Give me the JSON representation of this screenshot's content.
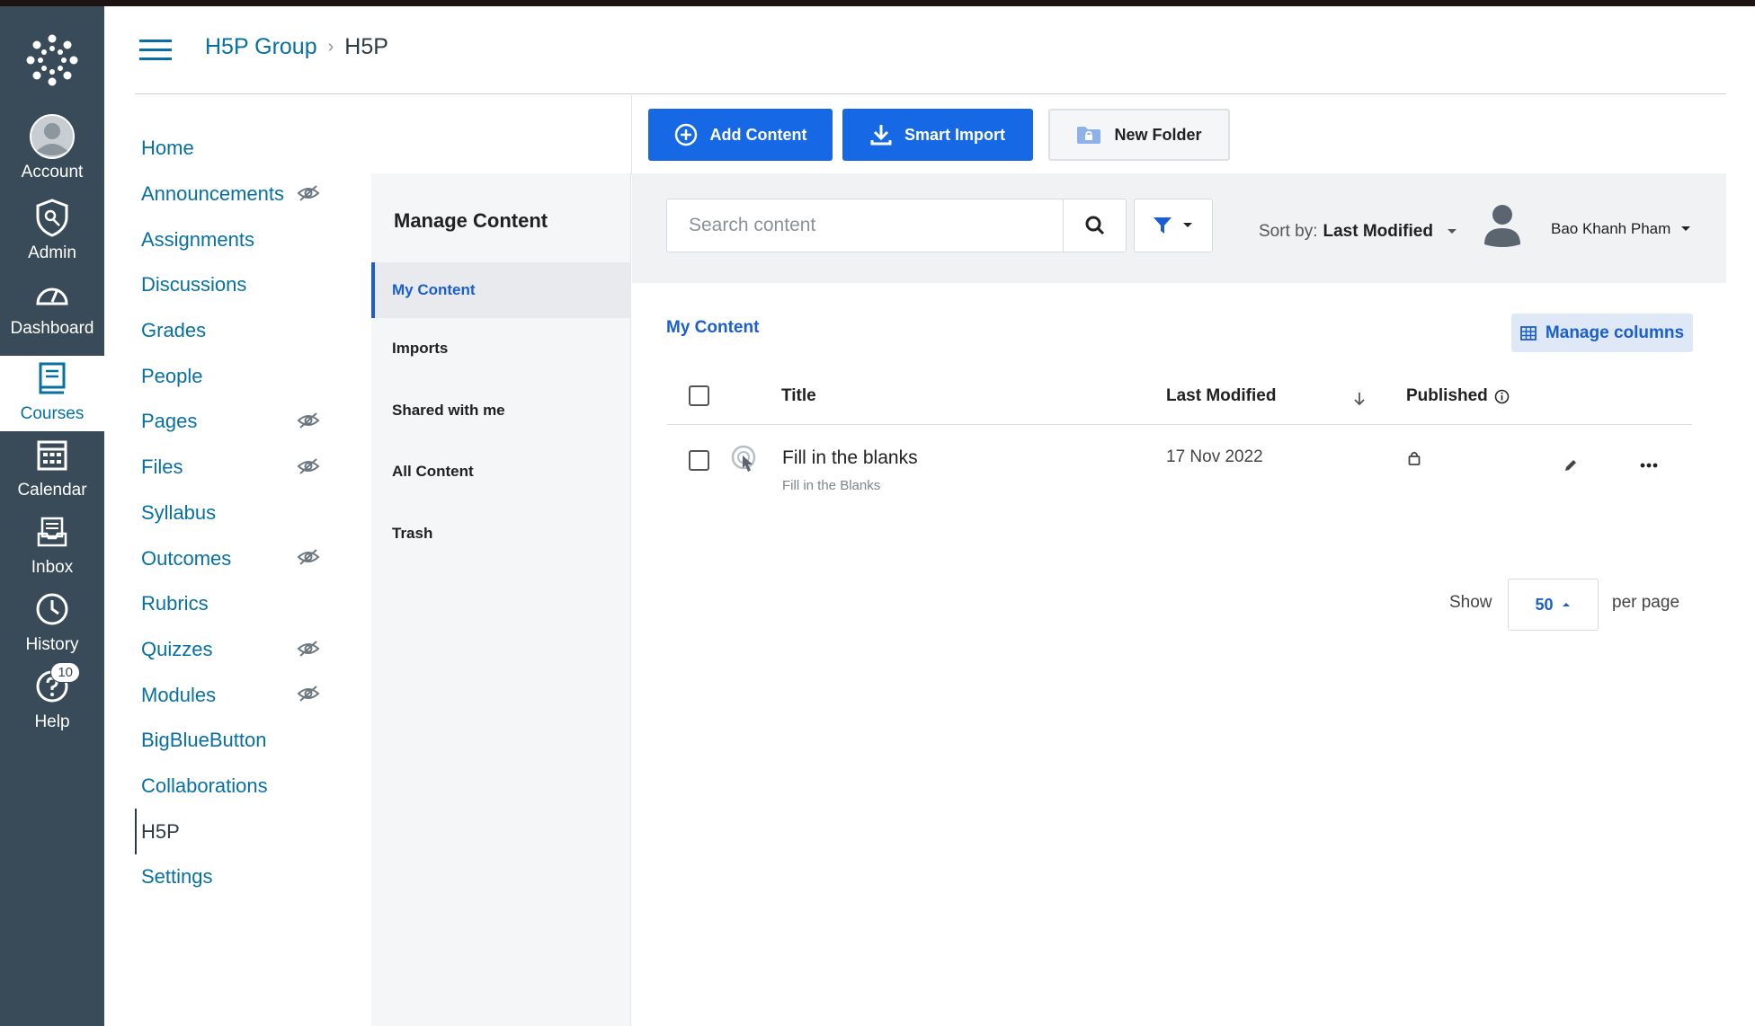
{
  "global_nav": {
    "items": [
      {
        "label": "Account",
        "icon": "user-avatar-icon"
      },
      {
        "label": "Admin",
        "icon": "shield-icon"
      },
      {
        "label": "Dashboard",
        "icon": "speedometer-icon"
      },
      {
        "label": "Courses",
        "icon": "book-icon",
        "active": true
      },
      {
        "label": "Calendar",
        "icon": "calendar-icon"
      },
      {
        "label": "Inbox",
        "icon": "inbox-icon"
      },
      {
        "label": "History",
        "icon": "clock-icon"
      },
      {
        "label": "Help",
        "icon": "help-icon",
        "badge": "10"
      }
    ]
  },
  "breadcrumb": {
    "group": "H5P Group",
    "current": "H5P"
  },
  "course_nav": {
    "items": [
      {
        "label": "Home"
      },
      {
        "label": "Announcements",
        "hidden_icon": true
      },
      {
        "label": "Assignments"
      },
      {
        "label": "Discussions"
      },
      {
        "label": "Grades"
      },
      {
        "label": "People"
      },
      {
        "label": "Pages",
        "hidden_icon": true
      },
      {
        "label": "Files",
        "hidden_icon": true
      },
      {
        "label": "Syllabus"
      },
      {
        "label": "Outcomes",
        "hidden_icon": true
      },
      {
        "label": "Rubrics"
      },
      {
        "label": "Quizzes",
        "hidden_icon": true
      },
      {
        "label": "Modules",
        "hidden_icon": true
      },
      {
        "label": "BigBlueButton"
      },
      {
        "label": "Collaborations"
      },
      {
        "label": "H5P",
        "active": true
      },
      {
        "label": "Settings"
      }
    ]
  },
  "h5p": {
    "sidebar_title": "Manage Content",
    "menu": [
      "My Content",
      "Imports",
      "Shared with me",
      "All Content",
      "Trash"
    ],
    "buttons": {
      "add": "Add Content",
      "import": "Smart Import",
      "folder": "New Folder"
    },
    "search": {
      "placeholder": "Search content",
      "value": ""
    },
    "sort": {
      "prefix": "Sort by:",
      "value": "Last Modified"
    },
    "user": "Bao Khanh Pham",
    "section_label": "My Content",
    "manage_columns": "Manage columns",
    "columns": {
      "title": "Title",
      "modified": "Last Modified",
      "published": "Published"
    },
    "rows": [
      {
        "title": "Fill in the blanks",
        "type": "Fill in the Blanks",
        "modified": "17 Nov 2022"
      }
    ],
    "pager": {
      "show": "Show",
      "value": "50",
      "per_page": "per page"
    }
  },
  "colors": {
    "canvas_nav": "#394b58",
    "link": "#0770a3",
    "h5p_blue": "#1768e4"
  }
}
